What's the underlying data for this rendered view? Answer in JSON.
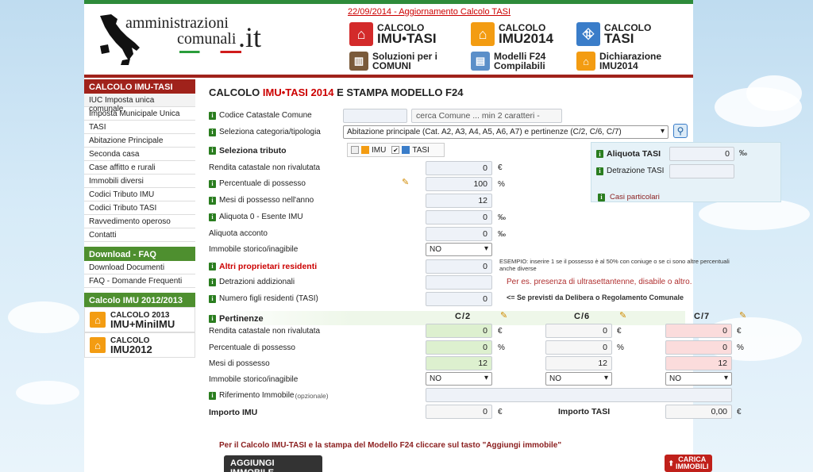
{
  "header": {
    "logo": {
      "line1": "amministrazioni",
      "line2": "comunali",
      "tld": ".it"
    },
    "news": "22/09/2014 - Aggiornamento Calcolo TASI",
    "buttons": [
      {
        "l1": "CALCOLO",
        "l2": "IMU•TASI",
        "color": "#d32a2a",
        "icon": "house-icon"
      },
      {
        "l1": "CALCOLO",
        "l2": "IMU2014",
        "color": "#f39c12",
        "icon": "house-icon"
      },
      {
        "l1": "CALCOLO",
        "l2": "TASI",
        "color": "#3a7dc9",
        "icon": "road-icon"
      },
      {
        "l1": "Soluzioni per i",
        "l2": "COMUNI",
        "color": "#7a5a3a",
        "icon": "building-icon"
      },
      {
        "l1": "Modelli F24",
        "l2": "Compilabili",
        "color": "#5b8fc9",
        "icon": "document-icon"
      },
      {
        "l1": "Dichiarazione",
        "l2": "IMU2014",
        "color": "#f39c12",
        "icon": "house-icon"
      }
    ]
  },
  "sidebar": {
    "section1": {
      "title": "CALCOLO IMU-TASI",
      "color": "#a0221b",
      "items": [
        "IUC Imposta unica comunale",
        "Imposta Municipale Unica",
        "TASI",
        "Abitazione Principale",
        "Seconda casa",
        "Case affitto e rurali",
        "Immobili diversi",
        "Codici Tributo IMU",
        "Codici Tributo TASI",
        "Ravvedimento operoso",
        "Contatti"
      ]
    },
    "section2": {
      "title": "Download - FAQ",
      "color": "#4e8f2f",
      "items": [
        "Download Documenti",
        "FAQ - Domande Frequenti"
      ]
    },
    "section3": {
      "title": "Calcolo IMU 2012/2013",
      "color": "#4e8f2f",
      "mini": [
        {
          "small": "CALCOLO 2013",
          "big": "IMU+MiniIMU"
        },
        {
          "small": "CALCOLO",
          "big": "IMU2012"
        }
      ]
    }
  },
  "form": {
    "title": {
      "a": "CALCOLO ",
      "b": "IMU•TASI 2014",
      "c": " E STAMPA MODELLO F24"
    },
    "codice_label": "Codice Catastale Comune",
    "comune_placeholder": "cerca Comune ... min 2 caratteri -",
    "categoria_label": "Seleziona categoria/tipologia",
    "categoria_value": "Abitazione principale (Cat. A2, A3, A4, A5, A6, A7) e pertinenze (C/2, C/6, C/7)",
    "tributo_label": "Seleziona tributo",
    "imu": "IMU",
    "tasi": "TASI",
    "rendita_label": "Rendita catastale non rivalutata",
    "rendita": "0",
    "perc_label": "Percentuale di possesso",
    "perc": "100",
    "mesi_label": "Mesi di possesso nell'anno",
    "mesi": "12",
    "aliq0_label": "Aliquota 0 - Esente IMU",
    "aliq0": "0",
    "acconto_label": "Aliquota acconto",
    "acconto": "0",
    "storico_label": "Immobile storico/inagibile",
    "storico": "NO",
    "altri_label": "Altri proprietari residenti",
    "altri": "0",
    "esempio": "ESEMPIO: inserire 1 se il possesso è al 50% con coniuge o se ci sono altre percentuali anche diverse",
    "detraz_label": "Detrazioni addizionali",
    "detraz_hint": "Per es. presenza di ultrasettantenne, disabile o altro.",
    "figli_label": "Numero figli residenti (TASI)",
    "figli": "0",
    "figli_hint": "<= Se previsti da Delibera o Regolamento Comunale",
    "unit_euro": "€",
    "unit_perc": "%",
    "unit_mille": "‰",
    "panel": {
      "aliquota_tasi_label": "Aliquota TASI",
      "aliquota_tasi": "0",
      "detrazione_tasi_label": "Detrazione TASI",
      "casi": "Casi particolari"
    },
    "pertinenze": {
      "label": "Pertinenze",
      "cols": [
        "C/2",
        "C/6",
        "C/7"
      ],
      "rendita_label": "Rendita catastale non rivalutata",
      "rendita": [
        "0",
        "0",
        "0"
      ],
      "perc_label": "Percentuale di possesso",
      "perc": [
        "0",
        "0",
        "0"
      ],
      "mesi_label": "Mesi di possesso",
      "mesi": [
        "12",
        "12",
        "12"
      ],
      "storico_label": "Immobile storico/inagibile",
      "storico": [
        "NO",
        "NO",
        "NO"
      ]
    },
    "riferimento_label": "Riferimento Immobile",
    "riferimento_opt": "(opzionale)",
    "importo_imu_label": "Importo IMU",
    "importo_imu": "0",
    "importo_tasi_label": "Importo TASI",
    "importo_tasi": "0,00",
    "note": "Per il Calcolo IMU-TASI e la stampa del Modello F24 cliccare sul tasto \"Aggiungi immobile\"",
    "aggiungi": "AGGIUNGI IMMOBILE",
    "carica": "CARICA IMMOBILI"
  }
}
